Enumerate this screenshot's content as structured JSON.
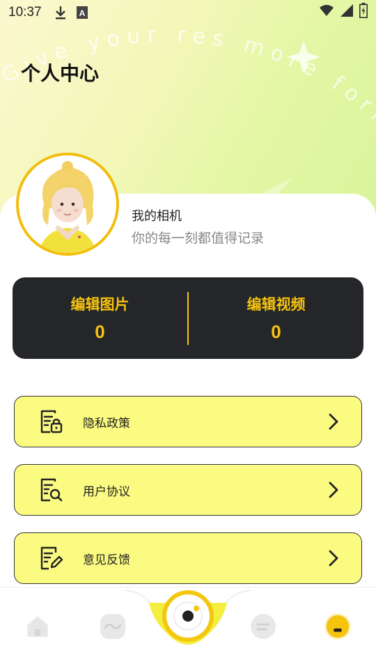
{
  "status_bar": {
    "time": "10:37",
    "left_icons": [
      "download-icon",
      "font-icon"
    ],
    "right_icons": [
      "wifi-icon",
      "signal-icon",
      "battery-icon"
    ]
  },
  "decor_text": "Give your res more forms of pren",
  "header": {
    "title": "个人中心"
  },
  "profile": {
    "name": "我的相机",
    "subtitle": "你的每一刻都值得记录",
    "avatar_icon": "avatar-girl-icon"
  },
  "stats": [
    {
      "label": "编辑图片",
      "value": "0"
    },
    {
      "label": "编辑视频",
      "value": "0"
    }
  ],
  "menu": [
    {
      "label": "隐私政策",
      "icon": "privacy-doc-lock-icon"
    },
    {
      "label": "用户协议",
      "icon": "agreement-doc-search-icon"
    },
    {
      "label": "意见反馈",
      "icon": "feedback-doc-edit-icon"
    }
  ],
  "tabbar": {
    "tabs": [
      {
        "icon": "home-icon",
        "active": false
      },
      {
        "icon": "wave-icon",
        "active": false
      },
      {
        "icon": "camera-shutter-icon",
        "active": false
      },
      {
        "icon": "list-icon",
        "active": false
      },
      {
        "icon": "profile-icon",
        "active": true
      }
    ]
  },
  "colors": {
    "accent_yellow": "#f6c30e",
    "menu_bg": "#fbfb82",
    "stats_bg": "#25262a"
  }
}
